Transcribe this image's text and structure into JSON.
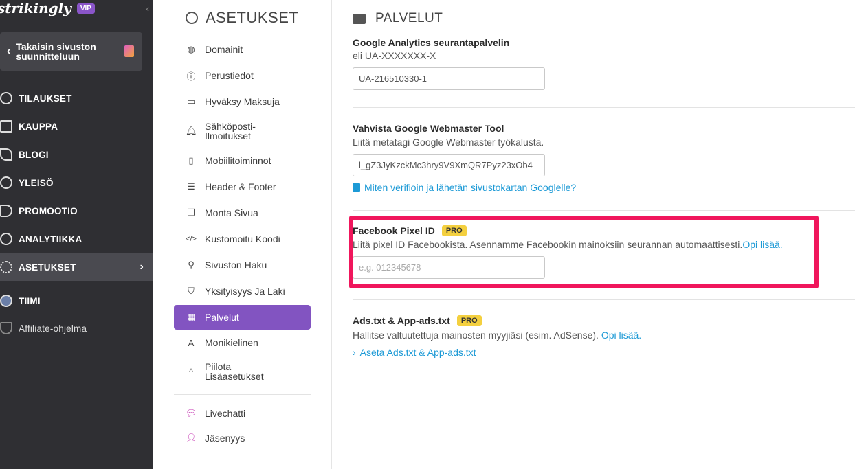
{
  "brand": {
    "logo": "strikingly",
    "badge": "VIP"
  },
  "left_nav": {
    "back_label": "Takaisin sivuston suunnitteluun",
    "items": [
      {
        "label": "TILAUKSET",
        "icon": "dollar-icon"
      },
      {
        "label": "KAUPPA",
        "icon": "store-icon"
      },
      {
        "label": "BLOGI",
        "icon": "quill-icon"
      },
      {
        "label": "YLEISÖ",
        "icon": "people-icon"
      },
      {
        "label": "PROMOOTIO",
        "icon": "megaphone-icon"
      },
      {
        "label": "ANALYTIIKKA",
        "icon": "pie-chart-icon"
      },
      {
        "label": "ASETUKSET",
        "icon": "gear-icon"
      },
      {
        "label": "TIIMI",
        "icon": "team-icon"
      },
      {
        "label": "Affiliate-ohjelma",
        "icon": "trophy-icon"
      }
    ]
  },
  "settings": {
    "title": "ASETUKSET",
    "items": [
      {
        "label": "Domainit",
        "icon": "globe-icon",
        "glyph": "◍"
      },
      {
        "label": "Perustiedot",
        "icon": "info-icon",
        "glyph": "ⓘ"
      },
      {
        "label": "Hyväksy Maksuja",
        "icon": "payment-icon",
        "glyph": "▭"
      },
      {
        "label": "Sähköposti-Ilmoitukset",
        "icon": "bell-icon",
        "glyph": "🔔︎"
      },
      {
        "label": "Mobiilitoiminnot",
        "icon": "mobile-icon",
        "glyph": "▯"
      },
      {
        "label": "Header & Footer",
        "icon": "header-footer-icon",
        "glyph": "☰"
      },
      {
        "label": "Monta Sivua",
        "icon": "pages-icon",
        "glyph": "❐"
      },
      {
        "label": "Kustomoitu Koodi",
        "icon": "code-icon",
        "glyph": "</>"
      },
      {
        "label": "Sivuston Haku",
        "icon": "search-icon",
        "glyph": "⚲"
      },
      {
        "label": "Yksityisyys Ja Laki",
        "icon": "shield-icon",
        "glyph": "⛉"
      },
      {
        "label": "Palvelut",
        "icon": "grid-icon",
        "glyph": "▦"
      },
      {
        "label": "Monikielinen",
        "icon": "translate-icon",
        "glyph": "A"
      },
      {
        "label": "Piilota Lisäasetukset",
        "icon": "chevron-up-icon",
        "glyph": "^"
      },
      {
        "label": "Livechatti",
        "icon": "chat-icon",
        "glyph": "💬︎"
      },
      {
        "label": "Jäsenyys",
        "icon": "member-icon",
        "glyph": "👤︎"
      }
    ]
  },
  "main": {
    "title": "PALVELUT",
    "ga": {
      "heading": "Google Analytics seurantapalvelin",
      "desc": "eli UA-XXXXXXX-X",
      "value": "UA-216510330-1"
    },
    "webmaster": {
      "heading": "Vahvista Google Webmaster Tool",
      "desc": "Liitä metatagi Google Webmaster työkalusta.",
      "value": "l_gZ3JyKzckMc3hry9V9XmQR7Pyz23xOb4",
      "link": "Miten verifioin ja lähetän sivustokartan Googlelle?"
    },
    "pixel": {
      "heading": "Facebook Pixel ID",
      "badge": "PRO",
      "desc": "Liitä pixel ID Facebookista. Asennamme Facebookin mainoksiin seurannan automaattisesti.",
      "link": "Opi lisää.",
      "placeholder": "e.g. 012345678"
    },
    "ads": {
      "heading": "Ads.txt & App-ads.txt",
      "badge": "PRO",
      "desc": "Hallitse valtuutettuja mainosten myyjiäsi (esim. AdSense).",
      "link": "Opi lisää.",
      "action": "Aseta Ads.txt & App-ads.txt"
    }
  },
  "colors": {
    "accent": "#8254c1",
    "link": "#1d9ad6",
    "highlight": "#f0165c",
    "pro": "#f4d03f"
  }
}
